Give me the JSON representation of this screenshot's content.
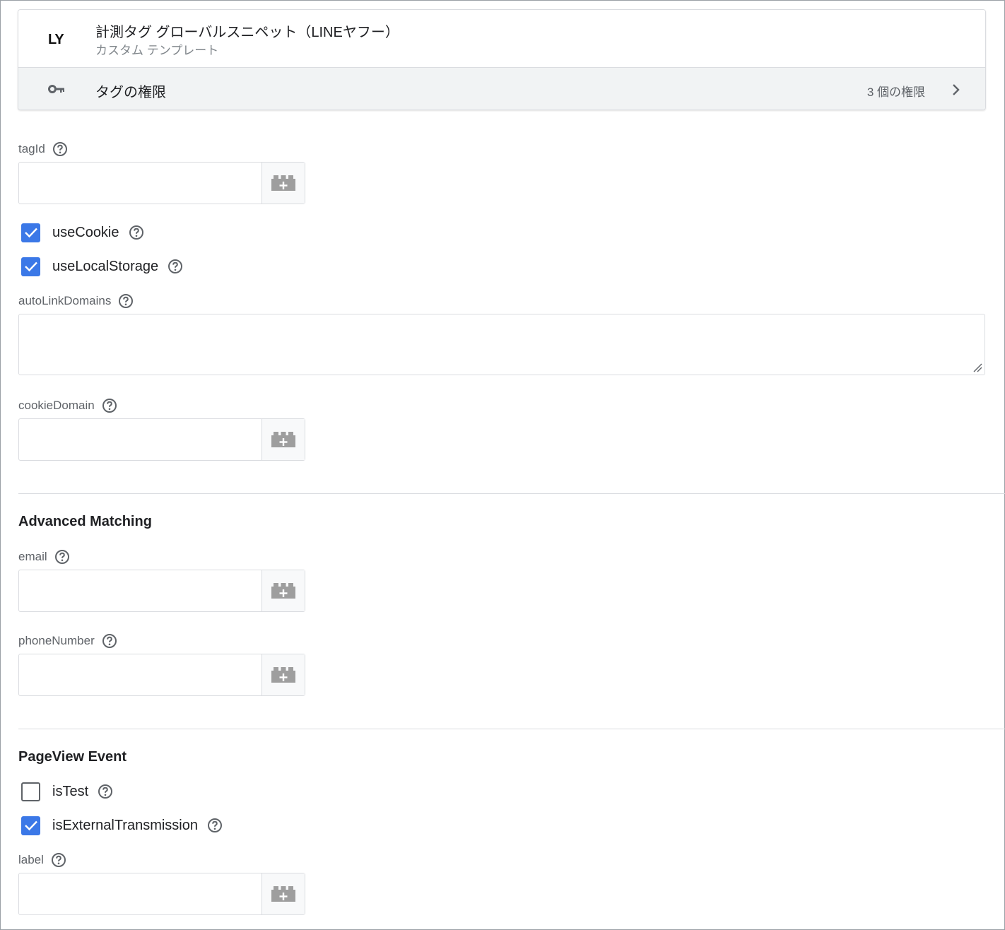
{
  "template": {
    "logo_text": "LY",
    "title": "計測タグ グローバルスニペット（LINEヤフー）",
    "subtitle": "カスタム テンプレート"
  },
  "permissions": {
    "label": "タグの権限",
    "count": "3 個の権限"
  },
  "fields": {
    "tagId": {
      "label": "tagId",
      "value": ""
    },
    "useCookie": {
      "label": "useCookie",
      "checked": true
    },
    "useLocalStorage": {
      "label": "useLocalStorage",
      "checked": true
    },
    "autoLinkDomains": {
      "label": "autoLinkDomains",
      "value": ""
    },
    "cookieDomain": {
      "label": "cookieDomain",
      "value": ""
    }
  },
  "advanced": {
    "title": "Advanced Matching",
    "email": {
      "label": "email",
      "value": ""
    },
    "phoneNumber": {
      "label": "phoneNumber",
      "value": ""
    }
  },
  "pageview": {
    "title": "PageView Event",
    "isTest": {
      "label": "isTest",
      "checked": false
    },
    "isExternalTransmission": {
      "label": "isExternalTransmission",
      "checked": true
    },
    "label": {
      "label": "label",
      "value": ""
    }
  },
  "icons": {
    "help": "help-circle-icon",
    "variable": "add-variable-block-icon",
    "key": "key-icon",
    "chevron": "chevron-right-icon",
    "check": "checkmark-icon"
  },
  "colors": {
    "checkbox_checked": "#3b78e7",
    "variable_icon": "#9e9e9e",
    "border": "#dadce0",
    "permissions_bg": "#f1f3f4"
  }
}
